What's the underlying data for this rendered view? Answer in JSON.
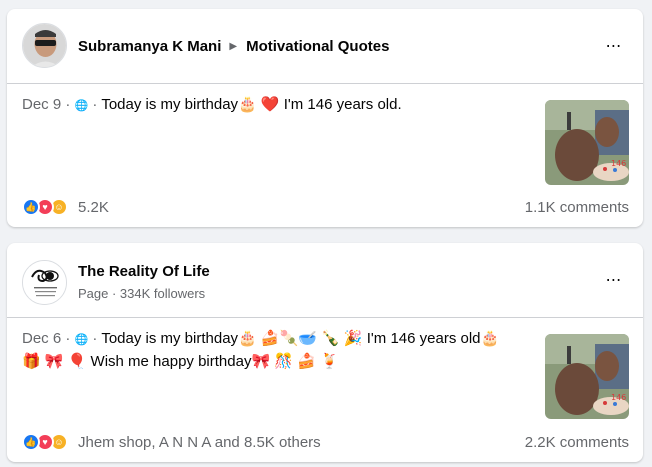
{
  "posts": [
    {
      "author": "Subramanya K Mani",
      "group": "Motivational Quotes",
      "date": "Dec 9",
      "text": "Today is my birthday🎂 ❤️  I'm 146 years old.",
      "reaction_count": "5.2K",
      "comments": "1.1K comments"
    },
    {
      "author": "The Reality Of Life",
      "subline": "Page · 334K followers",
      "date": "Dec 6",
      "text_line1": "Today is my birthday🎂 🍰🍡🥣 🍾 🎉 I'm 146 years old🎂",
      "text_line2": "🎁 🎀 🎈 Wish me happy birthday🎀 🎊 🍰 🍹",
      "reaction_text": "Jhem shop, A N N A and 8.5K others",
      "comments": "2.2K comments"
    }
  ],
  "icons": {
    "more": "⋯",
    "caret": "▶",
    "globe": "🌐"
  },
  "colors": {
    "secondary_text": "#65676b",
    "like_blue": "#1877f2",
    "love_red": "#f33e58",
    "care_yellow": "#f7b125"
  }
}
